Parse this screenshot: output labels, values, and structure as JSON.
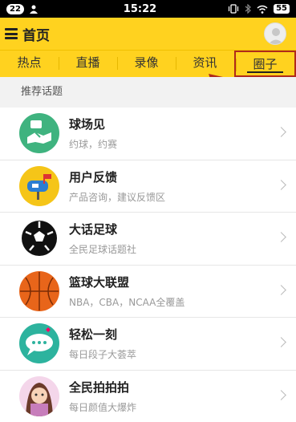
{
  "status_bar": {
    "notif_count": "22",
    "time": "15:22",
    "battery": "55"
  },
  "header": {
    "title": "首页"
  },
  "tabs": [
    {
      "label": "热点"
    },
    {
      "label": "直播"
    },
    {
      "label": "录像"
    },
    {
      "label": "资讯"
    },
    {
      "label": "圈子"
    }
  ],
  "section": {
    "title": "推荐话题"
  },
  "topics": [
    {
      "title": "球场见",
      "subtitle": "约球，约赛",
      "icon": "handshake-icon",
      "color": "#3fb37f"
    },
    {
      "title": "用户反馈",
      "subtitle": "产品咨询，建议反馈区",
      "icon": "mailbox-icon",
      "color": "#f5c518"
    },
    {
      "title": "大话足球",
      "subtitle": "全民足球话题社",
      "icon": "soccer-ball-icon",
      "color": "#111111"
    },
    {
      "title": "篮球大联盟",
      "subtitle": "NBA，CBA，NCAA全覆盖",
      "icon": "basketball-icon",
      "color": "#e8651a"
    },
    {
      "title": "轻松一刻",
      "subtitle": "每日段子大荟萃",
      "icon": "chat-bubble-icon",
      "color": "#2db39e"
    },
    {
      "title": "全民拍拍拍",
      "subtitle": "每日颜值大爆炸",
      "icon": "girl-avatar-icon",
      "color": "#c77dbb"
    }
  ]
}
